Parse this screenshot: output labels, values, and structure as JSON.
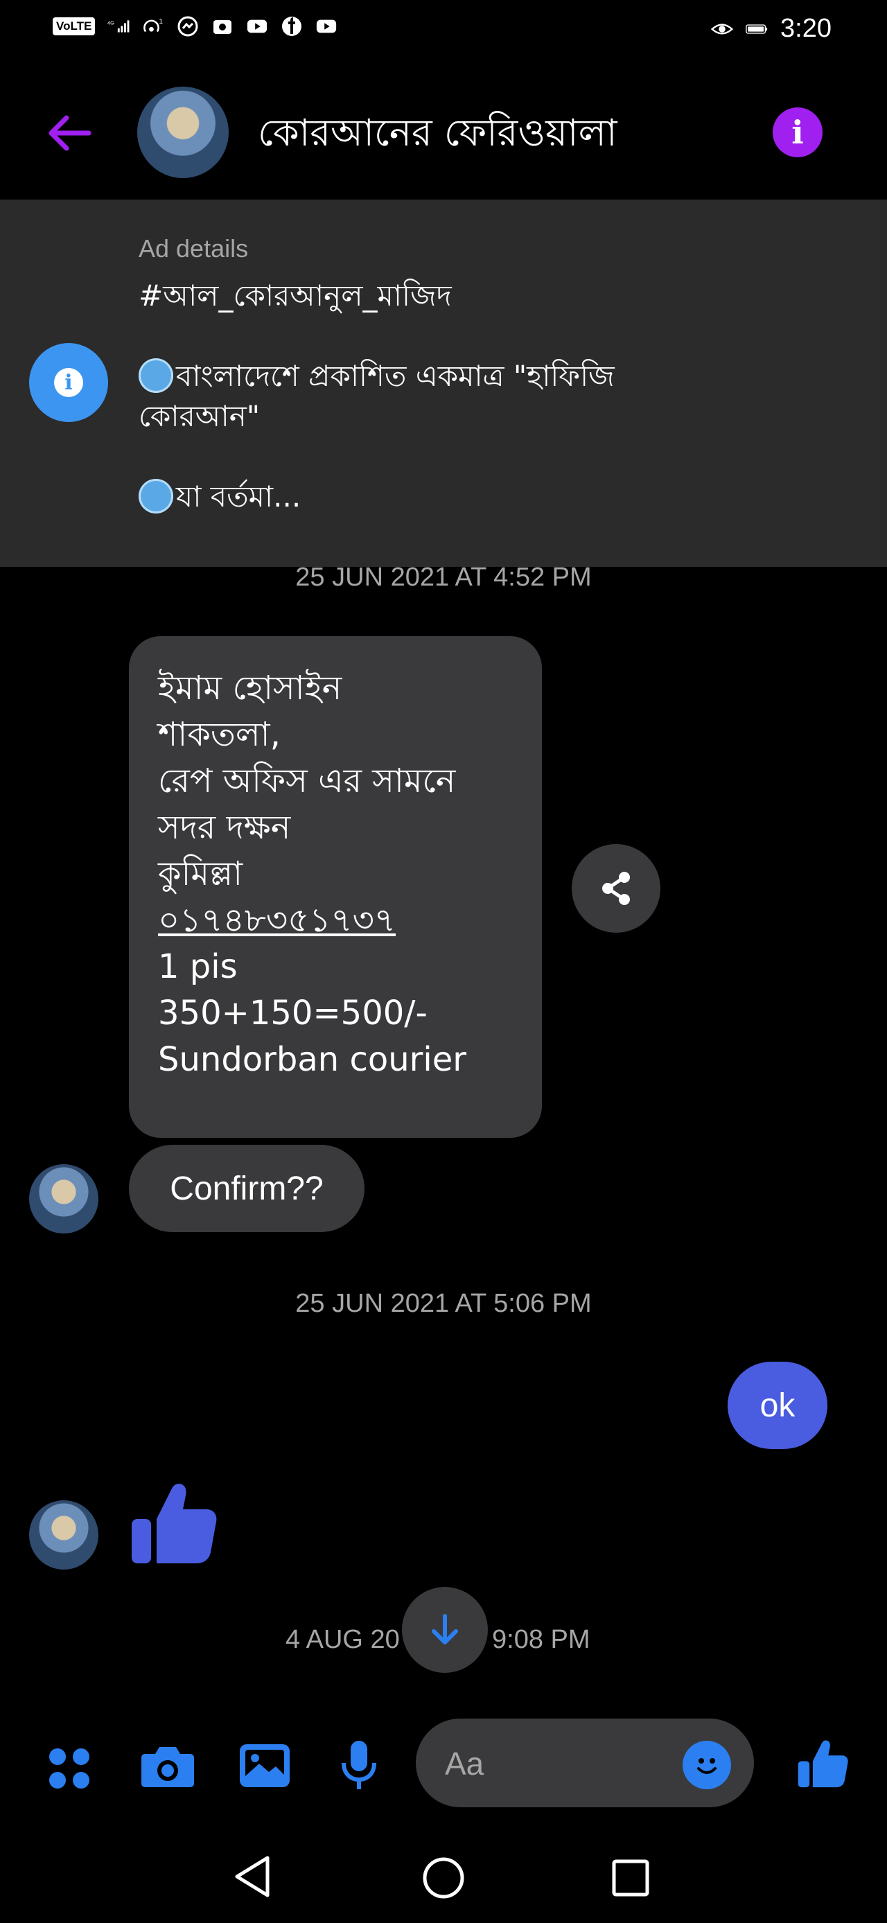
{
  "status_bar": {
    "volte": "VoLTE",
    "network": "4G",
    "hotspot": "1",
    "time": "3:20",
    "icons": [
      "signal-icon",
      "hotspot-icon",
      "messenger-icon",
      "camera-icon",
      "youtube-icon",
      "facebook-icon",
      "youtube-icon",
      "eye-icon",
      "battery-icon"
    ]
  },
  "header": {
    "title": "কোরআনের ফেরিওয়ালা",
    "icons": [
      "back-arrow-icon",
      "info-icon"
    ],
    "accent": "#a020f0"
  },
  "ad": {
    "label": "Ad details",
    "hashtag": "#আল_কোরআনুল_মাজিদ",
    "line1": "বাংলাদেশে প্রকাশিত একমাত্র \"হাফিজি",
    "line2": "কোরআন\"",
    "line3": "যা বর্তমা..."
  },
  "timestamps": {
    "t1": "25 JUN 2021 AT 4:52 PM",
    "t2": "25 JUN 2021 AT 5:06 PM",
    "t3_left": "4 AUG 20",
    "t3_right": "9:08 PM"
  },
  "messages": {
    "address": {
      "line1": "ইমাম হোসাইন",
      "line2": "শাকতলা,",
      "line3": "রেপ অফিস এর সামনে",
      "line4": "সদর দক্ষন",
      "line5": "কুমিল্লা",
      "phone": "০১৭৪৮৩৫১৭৩৭",
      "line7": "1 pis",
      "line8": "350+150=500/-",
      "line9": "Sundorban courier"
    },
    "confirm": "Confirm??",
    "outgoing": "ok"
  },
  "composer": {
    "placeholder": "Aa",
    "icons": [
      "apps-icon",
      "camera-icon",
      "image-icon",
      "microphone-icon",
      "emoji-icon",
      "like-icon"
    ]
  },
  "colors": {
    "messenger_blue": "#2b7ff0",
    "outgoing_bubble": "#4a5de0",
    "incoming_bubble": "#3a3a3c",
    "ad_panel": "#2b2b2b"
  }
}
